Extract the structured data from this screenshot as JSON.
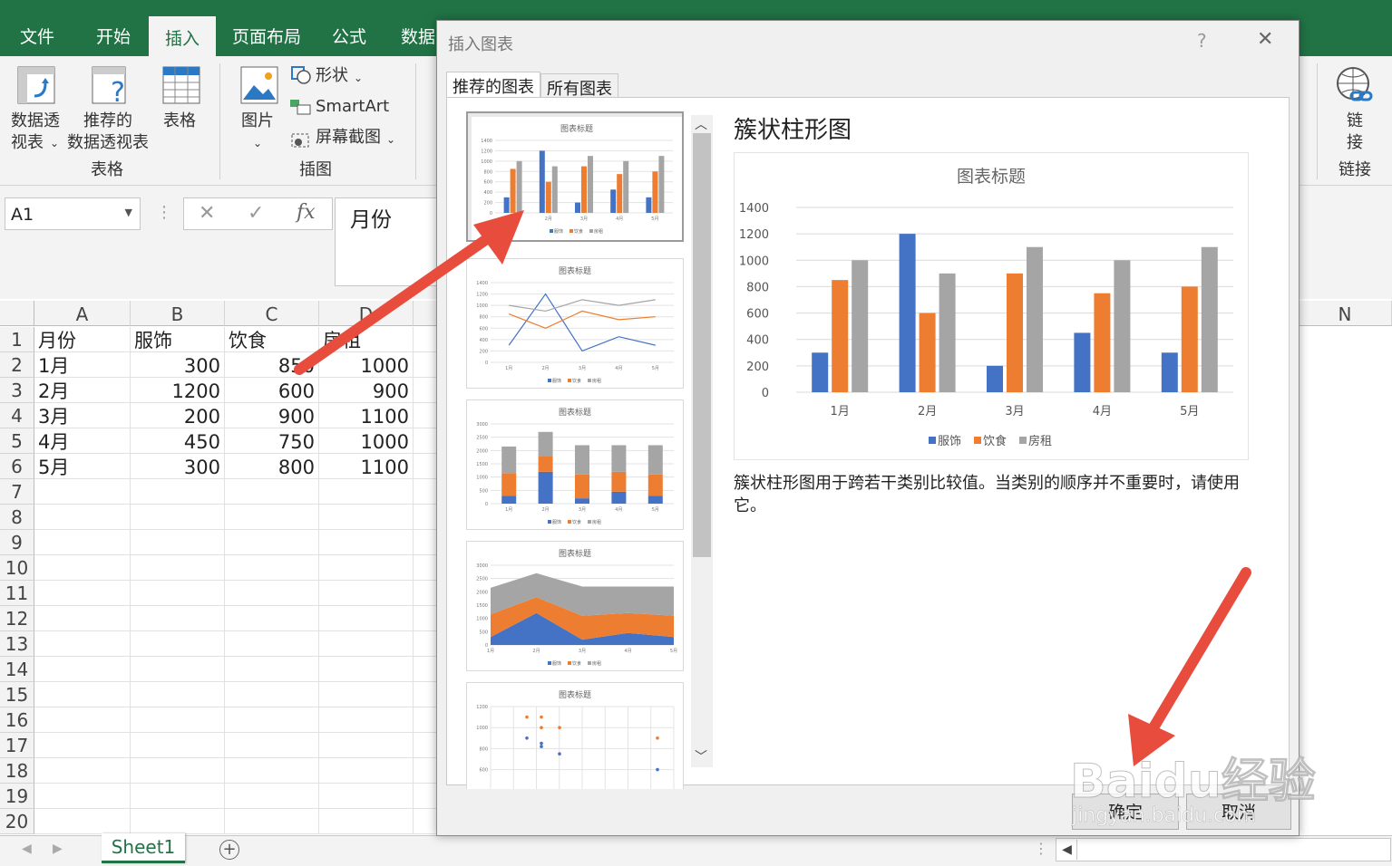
{
  "ribbon": {
    "tabs": [
      "文件",
      "开始",
      "插入",
      "页面布局",
      "公式",
      "数据"
    ],
    "active_tab": "插入",
    "groups": {
      "tables": {
        "label": "表格",
        "pivot_line1": "数据透",
        "pivot_line2": "视表",
        "recommended_line1": "推荐的",
        "recommended_line2": "数据透视表",
        "table": "表格"
      },
      "illustrations": {
        "label": "插图",
        "pictures": "图片",
        "shapes": "形状",
        "smartart": "SmartArt",
        "screenshot": "屏幕截图"
      },
      "links": {
        "label": "链接",
        "link_line1": "链",
        "link_line2": "接"
      }
    }
  },
  "formula_bar": {
    "name_box": "A1",
    "formula": "月份",
    "cancel_glyph": "✕",
    "enter_glyph": "✓",
    "fx": "fx"
  },
  "sheet": {
    "columns": [
      "A",
      "B",
      "C",
      "D"
    ],
    "far_column": "N",
    "rows": [
      [
        "月份",
        "服饰",
        "饮食",
        "房租"
      ],
      [
        "1月",
        "300",
        "850",
        "1000"
      ],
      [
        "2月",
        "1200",
        "600",
        "900"
      ],
      [
        "3月",
        "200",
        "900",
        "1100"
      ],
      [
        "4月",
        "450",
        "750",
        "1000"
      ],
      [
        "5月",
        "300",
        "800",
        "1100"
      ]
    ],
    "row_numbers": [
      "1",
      "2",
      "3",
      "4",
      "5",
      "6",
      "7",
      "8",
      "9",
      "10",
      "11",
      "12",
      "13",
      "14",
      "15",
      "16",
      "17",
      "18",
      "19",
      "20"
    ],
    "tab_name": "Sheet1",
    "add_sheet_glyph": "+"
  },
  "dialog": {
    "title": "插入图表",
    "help": "?",
    "close": "✕",
    "tabs": [
      "推荐的图表",
      "所有图表"
    ],
    "selected_chart_name": "簇状柱形图",
    "description": "簇状柱形图用于跨若干类别比较值。当类别的顺序并不重要时，请使用它。",
    "ok": "确定",
    "cancel": "取消",
    "thumbnail_title": "图表标题",
    "thumbnails": [
      "clustered-column",
      "line",
      "stacked-column",
      "stacked-area",
      "scatter"
    ]
  },
  "watermark": {
    "text1": "Baidu经验",
    "text2": "jingyan.baidu.com"
  },
  "colors": {
    "excel_green": "#217346",
    "series1": "#4472c4",
    "series2": "#ed7d31",
    "series3": "#a5a5a5",
    "arrow": "#e74c3c"
  },
  "chart_data": {
    "type": "bar",
    "title": "图表标题",
    "categories": [
      "1月",
      "2月",
      "3月",
      "4月",
      "5月"
    ],
    "series": [
      {
        "name": "服饰",
        "values": [
          300,
          1200,
          200,
          450,
          300
        ]
      },
      {
        "name": "饮食",
        "values": [
          850,
          600,
          900,
          750,
          800
        ]
      },
      {
        "name": "房租",
        "values": [
          1000,
          900,
          1100,
          1000,
          1100
        ]
      }
    ],
    "yticks": [
      "0",
      "200",
      "400",
      "600",
      "800",
      "1000",
      "1200",
      "1400"
    ],
    "ylim": [
      0,
      1400
    ],
    "grid": true,
    "legend": "bottom"
  }
}
